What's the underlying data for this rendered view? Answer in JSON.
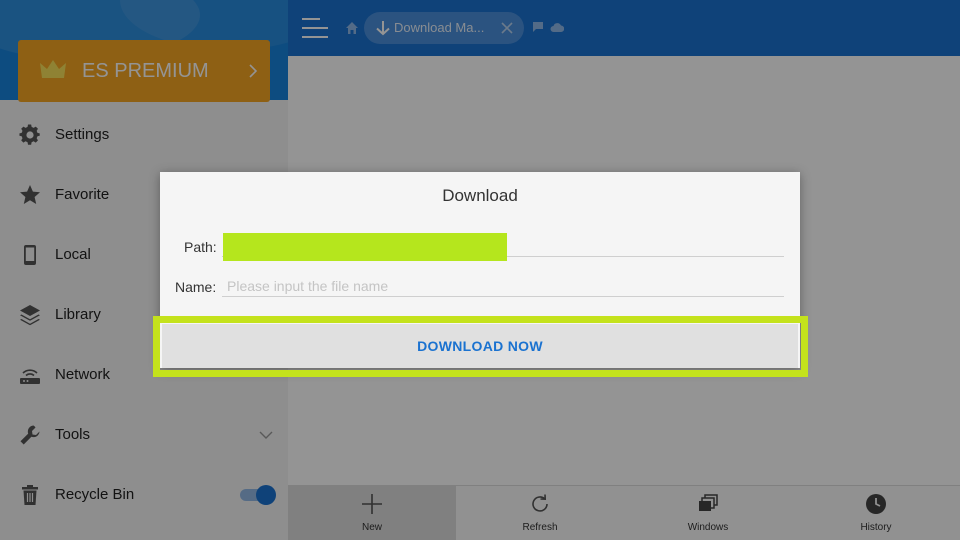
{
  "header": {
    "tab_label": "Download Ma...",
    "icons": [
      "menu-icon",
      "home-icon",
      "download-arrow-icon",
      "close-icon",
      "chat-icon",
      "cloud-icon"
    ]
  },
  "sidebar": {
    "premium_label": "ES PREMIUM",
    "items": [
      {
        "label": "Settings",
        "icon": "gear-icon"
      },
      {
        "label": "Favorite",
        "icon": "star-icon"
      },
      {
        "label": "Local",
        "icon": "phone-icon"
      },
      {
        "label": "Library",
        "icon": "layers-icon"
      },
      {
        "label": "Network",
        "icon": "router-icon"
      },
      {
        "label": "Tools",
        "icon": "wrench-icon"
      },
      {
        "label": "Recycle Bin",
        "icon": "trash-icon"
      }
    ],
    "recycle_bin_enabled": true
  },
  "toolbar": {
    "items": [
      {
        "label": "New",
        "icon": "plus-icon"
      },
      {
        "label": "Refresh",
        "icon": "refresh-icon"
      },
      {
        "label": "Windows",
        "icon": "windows-stack-icon"
      },
      {
        "label": "History",
        "icon": "clock-icon"
      }
    ]
  },
  "dialog": {
    "title": "Download",
    "path_label": "Path:",
    "path_value": "",
    "name_label": "Name:",
    "name_value": "",
    "name_placeholder": "Please input the file name",
    "button_label": "DOWNLOAD NOW"
  },
  "colors": {
    "accent": "#1a72d0",
    "premium": "#f5a623",
    "highlight": "#c4e21c",
    "path_redaction": "#b5e61d"
  }
}
